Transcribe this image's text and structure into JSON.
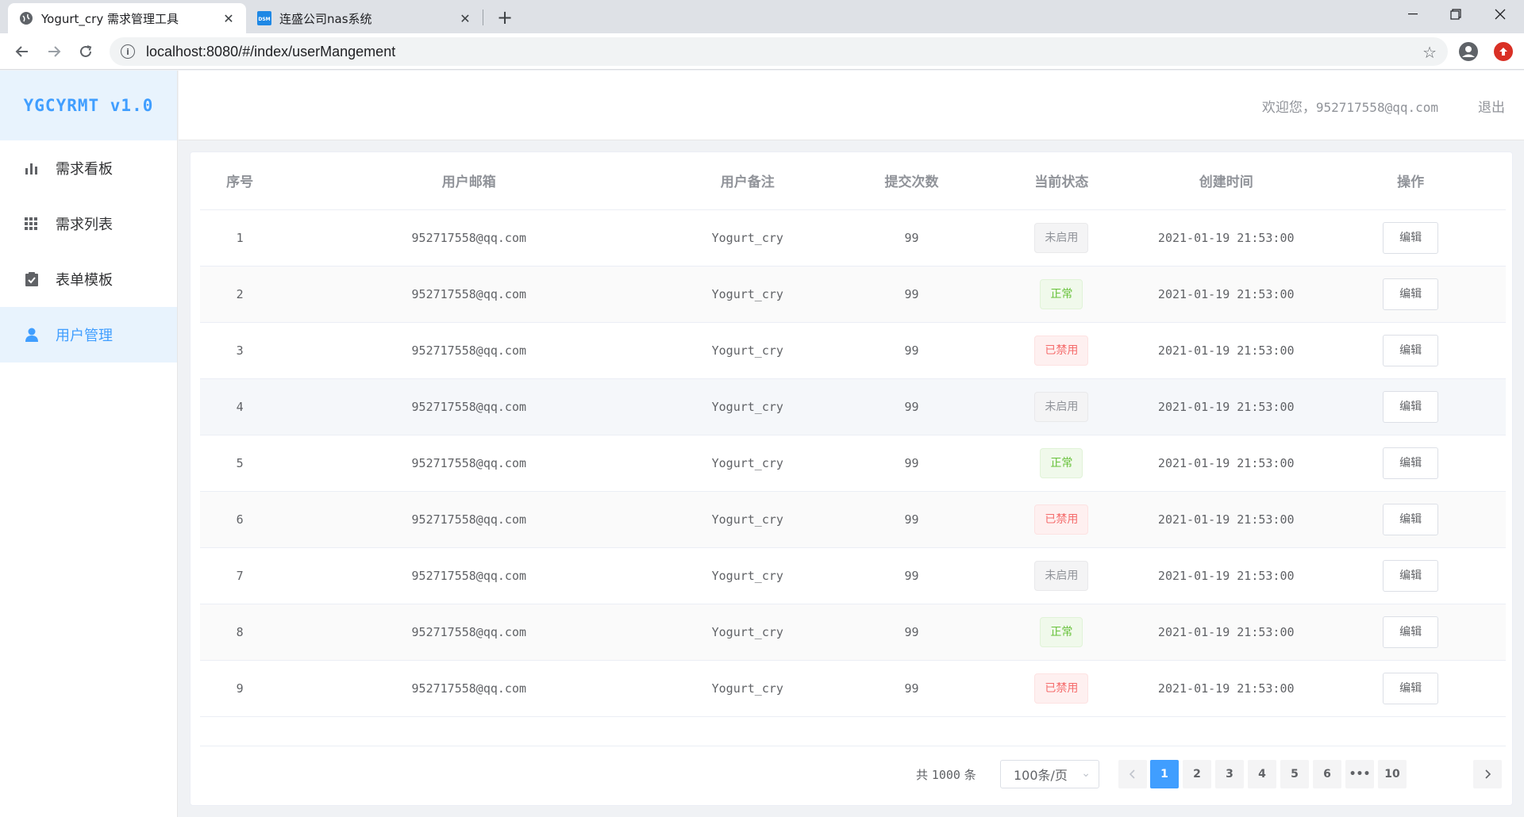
{
  "browser": {
    "tabs": [
      {
        "title": "Yogurt_cry 需求管理工具",
        "active": true
      },
      {
        "title": "连盛公司nas系统",
        "active": false
      }
    ],
    "url": "localhost:8080/#/index/userMangement",
    "window_controls": [
      "minimize",
      "maximize",
      "close"
    ]
  },
  "sidebar": {
    "logo": "YGCYRMT v1.0",
    "items": [
      {
        "label": "需求看板",
        "icon": "bar-chart-icon",
        "active": false
      },
      {
        "label": "需求列表",
        "icon": "grid-icon",
        "active": false
      },
      {
        "label": "表单模板",
        "icon": "clipboard-check-icon",
        "active": false
      },
      {
        "label": "用户管理",
        "icon": "user-icon",
        "active": true
      }
    ]
  },
  "header": {
    "welcome_prefix": "欢迎您，",
    "welcome_email": "952717558@qq.com",
    "logout": "退出"
  },
  "table": {
    "columns": [
      "序号",
      "用户邮箱",
      "用户备注",
      "提交次数",
      "当前状态",
      "创建时间",
      "操作"
    ],
    "rows": [
      {
        "index": "1",
        "email": "952717558@qq.com",
        "note": "Yogurt_cry",
        "count": "99",
        "status": "未启用",
        "status_type": "info",
        "created": "2021-01-19 21:53:00",
        "action": "编辑"
      },
      {
        "index": "2",
        "email": "952717558@qq.com",
        "note": "Yogurt_cry",
        "count": "99",
        "status": "正常",
        "status_type": "success",
        "created": "2021-01-19 21:53:00",
        "action": "编辑"
      },
      {
        "index": "3",
        "email": "952717558@qq.com",
        "note": "Yogurt_cry",
        "count": "99",
        "status": "已禁用",
        "status_type": "danger",
        "created": "2021-01-19 21:53:00",
        "action": "编辑"
      },
      {
        "index": "4",
        "email": "952717558@qq.com",
        "note": "Yogurt_cry",
        "count": "99",
        "status": "未启用",
        "status_type": "info",
        "created": "2021-01-19 21:53:00",
        "action": "编辑"
      },
      {
        "index": "5",
        "email": "952717558@qq.com",
        "note": "Yogurt_cry",
        "count": "99",
        "status": "正常",
        "status_type": "success",
        "created": "2021-01-19 21:53:00",
        "action": "编辑"
      },
      {
        "index": "6",
        "email": "952717558@qq.com",
        "note": "Yogurt_cry",
        "count": "99",
        "status": "已禁用",
        "status_type": "danger",
        "created": "2021-01-19 21:53:00",
        "action": "编辑"
      },
      {
        "index": "7",
        "email": "952717558@qq.com",
        "note": "Yogurt_cry",
        "count": "99",
        "status": "未启用",
        "status_type": "info",
        "created": "2021-01-19 21:53:00",
        "action": "编辑"
      },
      {
        "index": "8",
        "email": "952717558@qq.com",
        "note": "Yogurt_cry",
        "count": "99",
        "status": "正常",
        "status_type": "success",
        "created": "2021-01-19 21:53:00",
        "action": "编辑"
      },
      {
        "index": "9",
        "email": "952717558@qq.com",
        "note": "Yogurt_cry",
        "count": "99",
        "status": "已禁用",
        "status_type": "danger",
        "created": "2021-01-19 21:53:00",
        "action": "编辑"
      }
    ]
  },
  "pagination": {
    "total_prefix": "共",
    "total": "1000",
    "total_suffix": "条",
    "page_size": "100条/页",
    "pages": [
      "1",
      "2",
      "3",
      "4",
      "5",
      "6",
      "•••",
      "10"
    ],
    "current_page": "1"
  },
  "colors": {
    "accent": "#409eff",
    "success": "#67c23a",
    "danger": "#f56c6c",
    "info": "#909399"
  }
}
